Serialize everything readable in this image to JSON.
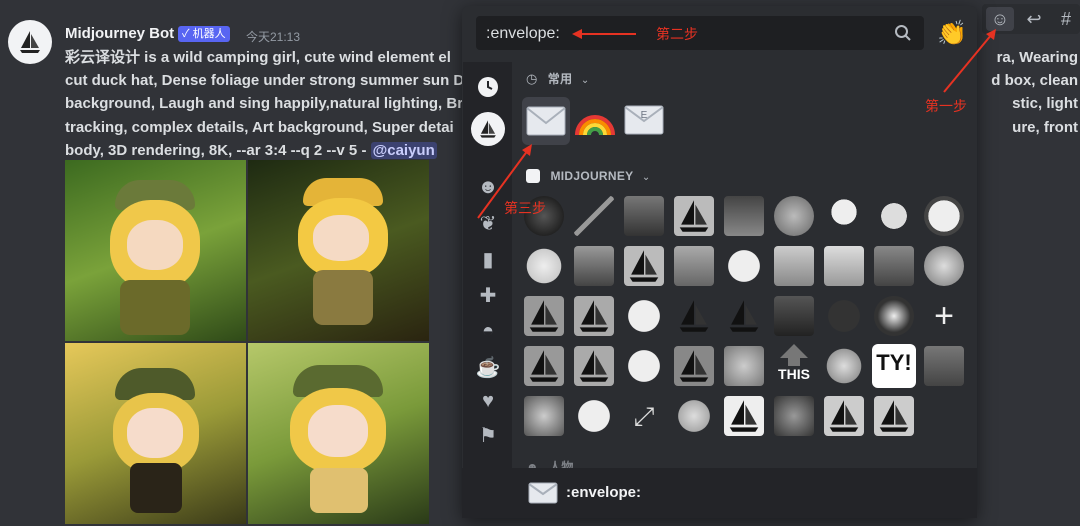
{
  "message": {
    "author": "Midjourney Bot",
    "badge": "✓ 机器人",
    "timestamp": "今天21:13",
    "lines": [
      "彩云译设计 is a wild camping girl, cute wind element el",
      "cut duck hat, Dense foliage under strong summer sun D",
      "background, Laugh and sing happily,natural lighting, Br",
      "tracking, complex details, Art background, Super detai",
      "body, 3D rendering, 8K,   --ar 3:4 --q 2 --v 5 -"
    ],
    "right_fragments": [
      "ra, Wearing",
      "d box, clean",
      "stic, light",
      "ure, front"
    ],
    "mention": "@caiyun"
  },
  "picker": {
    "search_value": ":envelope:",
    "frequent_label": "常用",
    "server_label": "MIDJOURNEY",
    "next_label": "人物",
    "this_label": "THIS",
    "ty_label": "TY!",
    "footer_name": ":envelope:"
  },
  "annotations": {
    "step1": "第一步",
    "step2": "第二步",
    "step3": "第三步"
  },
  "colors": {
    "accent": "#5865f2",
    "annotation": "#e63222",
    "background": "#313338"
  }
}
